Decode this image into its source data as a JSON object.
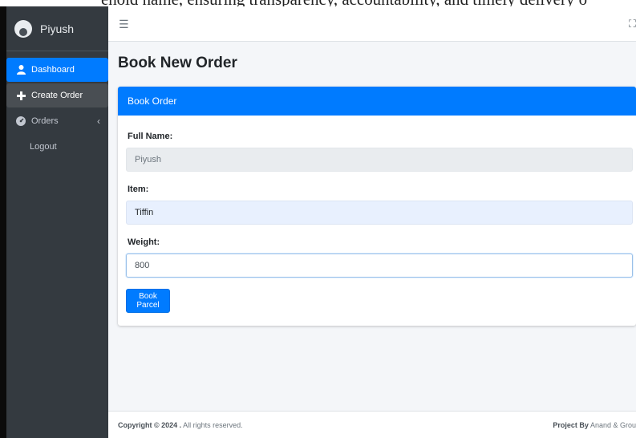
{
  "overlay_text": "ehold name, ensuring transparency, accountability, and timely delivery o",
  "brand": {
    "name": "Piyush"
  },
  "sidebar": {
    "items": [
      {
        "label": "Dashboard",
        "icon": "user-icon"
      },
      {
        "label": "Create Order",
        "icon": "plus-icon"
      },
      {
        "label": "Orders",
        "icon": "tachometer-icon"
      },
      {
        "label": "Logout"
      }
    ]
  },
  "topbar": {
    "menu_icon": "hamburger-icon",
    "expand_icon": "expand-icon"
  },
  "page": {
    "title": "Book New Order"
  },
  "card": {
    "header": "Book Order",
    "fields": [
      {
        "label": "Full Name:",
        "value": "Piyush"
      },
      {
        "label": "Item:",
        "value": "Tiffin"
      },
      {
        "label": "Weight:",
        "value": "800"
      }
    ],
    "submit_label": "Book Parcel"
  },
  "footer": {
    "copyright_bold": "Copyright © 2024 .",
    "copyright_rest": " All rights reserved.",
    "project_bold": "Project By",
    "project_rest": " Anand & Grou"
  },
  "colors": {
    "primary": "#007bff",
    "sidebar": "#343a40",
    "background": "#f4f6f9"
  }
}
